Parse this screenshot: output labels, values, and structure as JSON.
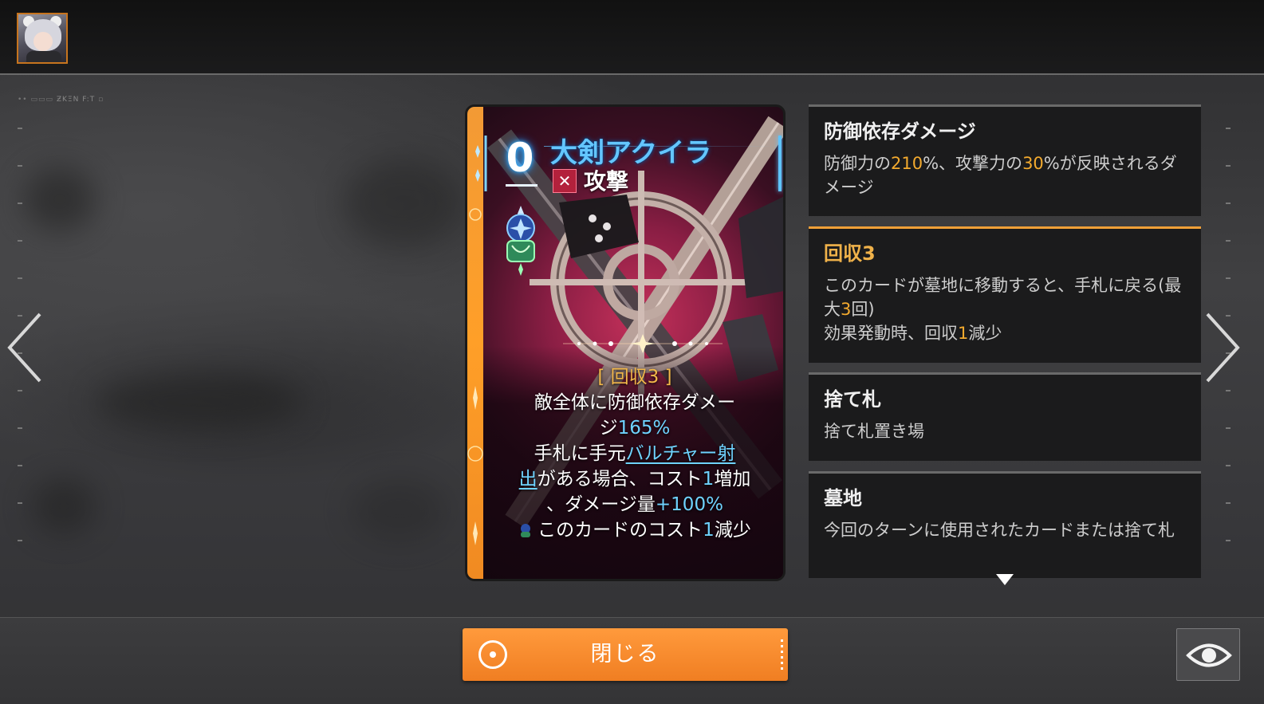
{
  "header": {
    "avatar_name": "avatar"
  },
  "hud": {
    "label": "ƵKΞN F:T"
  },
  "card": {
    "cost": "0",
    "name": "大剣アクイラ",
    "type_label": "攻撃",
    "type_icon": "crossed-swords-icon",
    "keyword": "[ 回収3 ]",
    "text": {
      "line1": "敵全体に防御依存ダメー",
      "line2_a": "ジ",
      "line2_b": "165%",
      "line3_a": "手札に手元",
      "line3_link": "バルチャー射",
      "line4_link": "出",
      "line4_b": "がある場合、コスト",
      "line4_c": "1",
      "line4_d": "増加",
      "line5_a": "、ダメージ量",
      "line5_b": "+100%",
      "line6_a": "このカードのコスト",
      "line6_b": "1",
      "line6_c": "減少"
    },
    "accent_color": "#f29a35",
    "name_color": "#64c6ff"
  },
  "panels": [
    {
      "title": "防御依存ダメージ",
      "body": [
        {
          "t": "防御力の"
        },
        {
          "t": "210",
          "hl": true
        },
        {
          "t": "%、攻撃力の"
        },
        {
          "t": "30",
          "hl": true
        },
        {
          "t": "%が反映されるダメージ"
        }
      ]
    },
    {
      "title": "回収3",
      "active": true,
      "body": [
        {
          "t": "このカードが墓地に移動すると、手札に戻る(最大"
        },
        {
          "t": "3",
          "hl": true
        },
        {
          "t": "回)"
        },
        {
          "br": true
        },
        {
          "t": "効果発動時、回収"
        },
        {
          "t": "1",
          "hl": true
        },
        {
          "t": "減少"
        }
      ]
    },
    {
      "title": "捨て札",
      "body": [
        {
          "t": "捨て札置き場"
        }
      ]
    },
    {
      "title": "墓地",
      "body": [
        {
          "t": "今回のターンに使用されたカードまたは捨て札"
        }
      ]
    }
  ],
  "buttons": {
    "close_label": "閉じる"
  },
  "colors": {
    "highlight": "#f3aa2e",
    "button": "#f48a2b",
    "panel_active_border": "#f0a038"
  }
}
